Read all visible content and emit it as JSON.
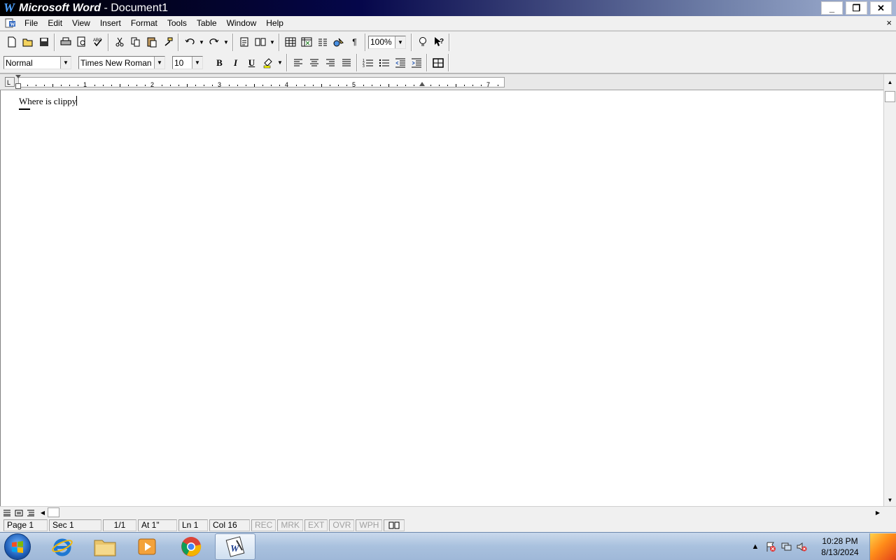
{
  "window": {
    "app_name": "Microsoft Word",
    "separator": " - ",
    "doc_name": "Document1",
    "logo_letter": "W"
  },
  "window_controls": {
    "minimize": "_",
    "restore": "❐",
    "close": "✕"
  },
  "menu": {
    "items": [
      "File",
      "Edit",
      "View",
      "Insert",
      "Format",
      "Tools",
      "Table",
      "Window",
      "Help"
    ],
    "close_glyph": "×"
  },
  "formatting": {
    "style": "Normal",
    "font": "Times New Roman",
    "size": "10",
    "bold": "B",
    "italic": "I",
    "underline": "U"
  },
  "standard_toolbar": {
    "zoom": "100%",
    "show_hide": "¶"
  },
  "ruler": {
    "numbers": [
      "1",
      "2",
      "3",
      "4",
      "5",
      "7"
    ],
    "tab_selector": "L"
  },
  "document": {
    "text": "Where is clippy"
  },
  "status": {
    "page": "Page 1",
    "sec": "Sec 1",
    "page_of": "1/1",
    "at": "At 1\"",
    "ln": "Ln 1",
    "col": "Col 16",
    "rec": "REC",
    "mrk": "MRK",
    "ext": "EXT",
    "ovr": "OVR",
    "wph": "WPH"
  },
  "taskbar": {
    "time": "10:28 PM",
    "date": "8/13/2024",
    "tray_arrow": "▲"
  },
  "colors": {
    "title_dark": "#05064a",
    "title_light": "#a6b6d6",
    "chrome": "#f0f0f0",
    "taskbar": "#a9c1de"
  }
}
